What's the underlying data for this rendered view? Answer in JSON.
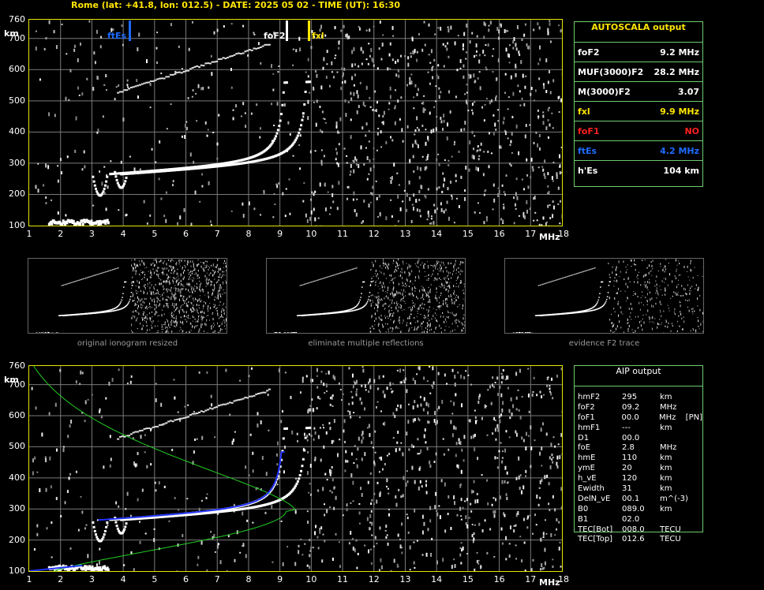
{
  "header": "Rome (lat: +41.8, lon: 012.5) - DATE: 2025 05 02 - TIME (UT): 16:30",
  "axes": {
    "y_unit": "km",
    "y_ticks": [
      "760",
      "700",
      "600",
      "500",
      "400",
      "300",
      "200",
      "100"
    ],
    "x_ticks": [
      "1",
      "2",
      "3",
      "4",
      "5",
      "6",
      "7",
      "8",
      "9",
      "10",
      "11",
      "12",
      "13",
      "14",
      "15",
      "16",
      "17",
      "18"
    ],
    "x_unit": "MHz",
    "x_range": [
      1,
      18
    ],
    "y_range": [
      100,
      760
    ]
  },
  "markers": {
    "ftEs": {
      "label": "ftEs",
      "freq": 4.2,
      "color": "#1e6cff"
    },
    "foF2": {
      "label": "foF2",
      "freq": 9.2,
      "color": "#ffffff"
    },
    "fxl": {
      "label": "fxl",
      "freq": 9.9,
      "color": "#ffe600"
    }
  },
  "autoscala": {
    "title": "AUTOSCALA output",
    "rows": [
      {
        "key": "foF2",
        "value": "9.2 MHz",
        "color": "#ffffff"
      },
      {
        "key": "MUF(3000)F2",
        "value": "28.2 MHz",
        "color": "#ffffff"
      },
      {
        "key": "M(3000)F2",
        "value": "3.07",
        "color": "#ffffff"
      },
      {
        "key": "fxl",
        "value": "9.9 MHz",
        "color": "#ffe600"
      },
      {
        "key": "foF1",
        "value": "NO",
        "color": "#ff2020"
      },
      {
        "key": "ftEs",
        "value": "4.2 MHz",
        "color": "#1e6cff"
      },
      {
        "key": "h'Es",
        "value": "104    km",
        "color": "#ffffff"
      }
    ]
  },
  "thumbnails": [
    {
      "caption": "original ionogram resized"
    },
    {
      "caption": "eliminate multiple reflections"
    },
    {
      "caption": "evidence F2 trace"
    }
  ],
  "aip": {
    "title": "AIP output",
    "rows": [
      {
        "k": "hmF2",
        "v": "295",
        "u": "km",
        "x": ""
      },
      {
        "k": "foF2",
        "v": "09.2",
        "u": "MHz",
        "x": ""
      },
      {
        "k": "foF1",
        "v": "00.0",
        "u": "MHz",
        "x": "[PN]"
      },
      {
        "k": "hmF1",
        "v": "---",
        "u": "km",
        "x": ""
      },
      {
        "k": "D1",
        "v": "00.0",
        "u": "",
        "x": ""
      },
      {
        "k": "foE",
        "v": "2.8",
        "u": "MHz",
        "x": ""
      },
      {
        "k": "hmE",
        "v": "110",
        "u": "km",
        "x": ""
      },
      {
        "k": "ymE",
        "v": "20",
        "u": "km",
        "x": ""
      },
      {
        "k": "h_vE",
        "v": "120",
        "u": "km",
        "x": ""
      },
      {
        "k": "Ewidth",
        "v": "31",
        "u": "km",
        "x": ""
      },
      {
        "k": "DelN_vE",
        "v": "00.1",
        "u": "m^(-3)",
        "x": ""
      },
      {
        "k": "B0",
        "v": "089.0",
        "u": "km",
        "x": ""
      },
      {
        "k": "B1",
        "v": "02.0",
        "u": "",
        "x": ""
      },
      {
        "k": "TEC[Bot]",
        "v": "008.0",
        "u": "TECU",
        "x": ""
      },
      {
        "k": "TEC[Top]",
        "v": "012.6",
        "u": "TECU",
        "x": ""
      }
    ]
  },
  "colors": {
    "frame": "#e6e600",
    "grid": "#7a7a7a",
    "panel_border": "#6ecb6e",
    "profile": "#22cc22",
    "trace_fit": "#2233ff"
  }
}
